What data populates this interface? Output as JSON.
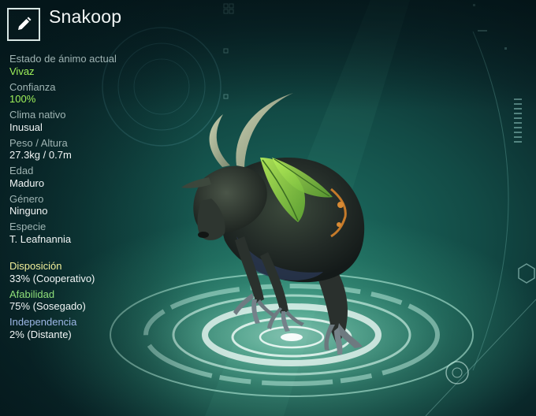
{
  "creature": {
    "name": "Snakoop"
  },
  "stats": [
    {
      "label": "Estado de ánimo actual",
      "value": "Vivaz",
      "highlight": true
    },
    {
      "label": "Confianza",
      "value": "100%",
      "highlight": true
    },
    {
      "label": "Clima nativo",
      "value": "Inusual",
      "highlight": false
    },
    {
      "label": "Peso / Altura",
      "value": "27.3kg / 0.7m",
      "highlight": false
    },
    {
      "label": "Edad",
      "value": "Maduro",
      "highlight": false
    },
    {
      "label": "Género",
      "value": "Ninguno",
      "highlight": false
    },
    {
      "label": "Especie",
      "value": "T. Leafnannia",
      "highlight": false
    }
  ],
  "traits": [
    {
      "label": "Disposición",
      "value": "33% (Cooperativo)",
      "color": "#f1ef9a"
    },
    {
      "label": "Afabilidad",
      "value": "75% (Sosegado)",
      "color": "#8fe07a"
    },
    {
      "label": "Independencia",
      "value": "2% (Distante)",
      "color": "#9db7e6"
    }
  ],
  "icons": {
    "edit": "pencil-icon"
  },
  "colors": {
    "highlight_green": "#9ff25a",
    "label_grey": "#9fb4b3",
    "value_white": "#f1f5f5"
  }
}
